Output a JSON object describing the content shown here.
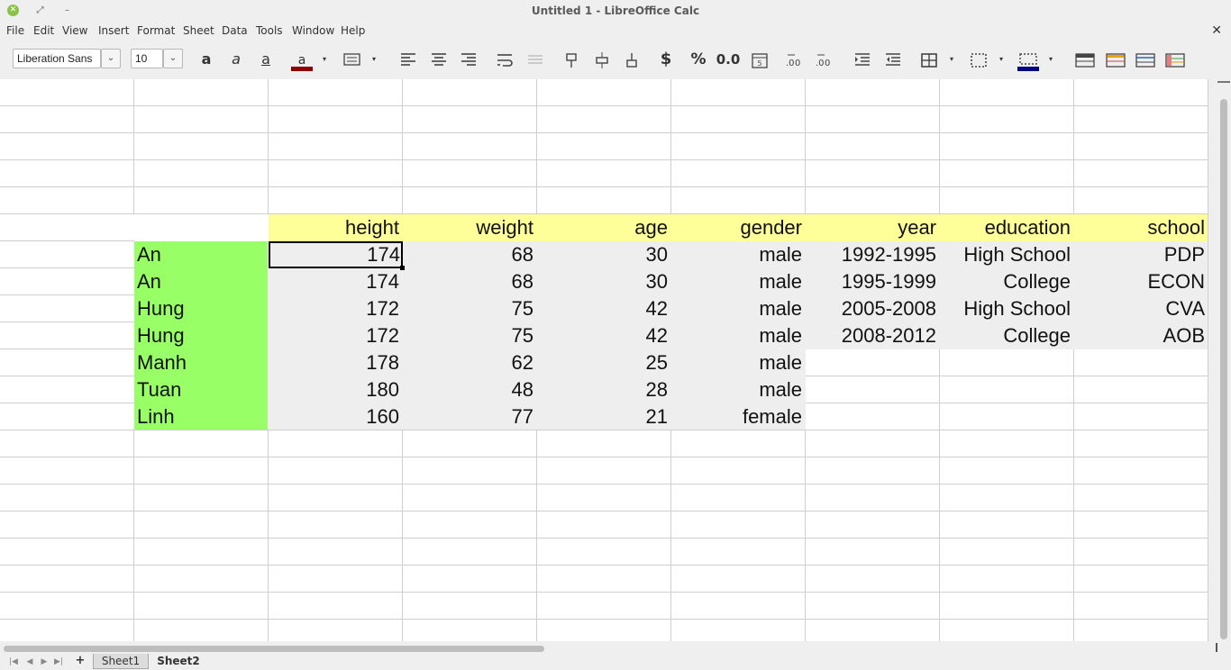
{
  "window": {
    "title": "Untitled 1 - LibreOffice Calc"
  },
  "menu": [
    "File",
    "Edit",
    "View",
    "Insert",
    "Format",
    "Sheet",
    "Data",
    "Tools",
    "Window",
    "Help"
  ],
  "toolbar": {
    "font_name": "Liberation Sans",
    "font_size": "10",
    "currency_label": "$",
    "percent_label": "%",
    "number_label": "0.0"
  },
  "colors": {
    "font_color": "#8b0000",
    "border_color": "#000080",
    "header_fill": "#ffff99",
    "name_fill": "#99ff66",
    "data_fill": "#eeeeee"
  },
  "table1": {
    "headers": [
      "height",
      "weight",
      "age",
      "gender"
    ],
    "rows": [
      {
        "name": "An",
        "height": "174",
        "weight": "68",
        "age": "30",
        "gender": "male"
      },
      {
        "name": "An",
        "height": "174",
        "weight": "68",
        "age": "30",
        "gender": "male"
      },
      {
        "name": "Hung",
        "height": "172",
        "weight": "75",
        "age": "42",
        "gender": "male"
      },
      {
        "name": "Hung",
        "height": "172",
        "weight": "75",
        "age": "42",
        "gender": "male"
      },
      {
        "name": "Manh",
        "height": "178",
        "weight": "62",
        "age": "25",
        "gender": "male"
      },
      {
        "name": "Tuan",
        "height": "180",
        "weight": "48",
        "age": "28",
        "gender": "male"
      },
      {
        "name": "Linh",
        "height": "160",
        "weight": "77",
        "age": "21",
        "gender": "female"
      }
    ]
  },
  "table2": {
    "headers": [
      "year",
      "education",
      "school"
    ],
    "rows": [
      {
        "year": "1992-1995",
        "education": "High School",
        "school": "PDP"
      },
      {
        "year": "1995-1999",
        "education": "College",
        "school": "ECON"
      },
      {
        "year": "2005-2008",
        "education": "High School",
        "school": "CVA"
      },
      {
        "year": "2008-2012",
        "education": "College",
        "school": "AOB"
      }
    ]
  },
  "tabs": {
    "sheet1": "Sheet1",
    "sheet2": "Sheet2"
  }
}
